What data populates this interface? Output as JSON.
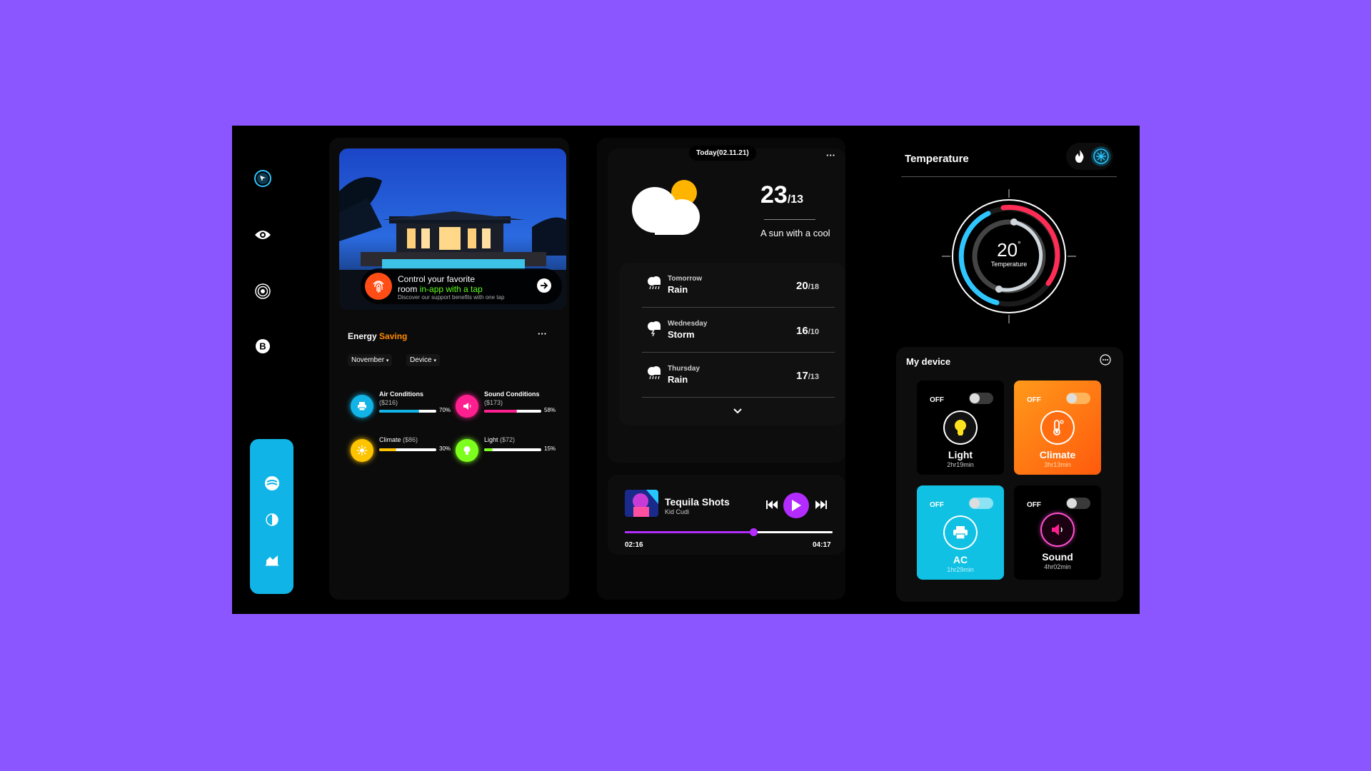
{
  "sidebar": {
    "icons": [
      "compass-icon",
      "eye-icon",
      "target-icon",
      "bitcoin-icon"
    ],
    "pill_icons": [
      "wind-icon",
      "contrast-icon",
      "chart-area-icon"
    ]
  },
  "hero": {
    "line1": "Control your favorite",
    "line2_pre": "room ",
    "line2_accent": "in-app with a tap",
    "sub": "Discover our support benefits with one tap"
  },
  "energy": {
    "title": "Energy",
    "title_accent": "Saving",
    "menu": "···",
    "filters": [
      "November",
      "Device"
    ],
    "items": [
      {
        "name": "Air Conditions",
        "cost": "($216)",
        "percent_label": "70%",
        "percent": 70,
        "color": "#12b3e6",
        "icon": "printer-icon"
      },
      {
        "name": "Sound Conditions",
        "cost": "($173)",
        "percent_label": "58%",
        "percent": 58,
        "color": "#ff1f8e",
        "icon": "speaker-icon"
      },
      {
        "name": "Climate",
        "cost": "($86)",
        "percent_label": "30%",
        "percent": 30,
        "color": "#ffc400",
        "icon": "sun-icon"
      },
      {
        "name": "Light",
        "cost": "($72)",
        "percent_label": "15%",
        "percent": 15,
        "color": "#7dff1e",
        "icon": "bulb-icon"
      }
    ]
  },
  "weather": {
    "date": "Today(02.11.21)",
    "menu": "···",
    "temp": "23",
    "temp_low": "/13",
    "desc": "A sun with a cool",
    "forecast": [
      {
        "day": "Tomorrow",
        "cond": "Rain",
        "hi": "20",
        "lo": "/18"
      },
      {
        "day": "Wednesday",
        "cond": "Storm",
        "hi": "16",
        "lo": "/10"
      },
      {
        "day": "Thursday",
        "cond": "Rain",
        "hi": "17",
        "lo": "/13"
      }
    ]
  },
  "music": {
    "title": "Tequila Shots",
    "artist": "Kid Cudi",
    "elapsed": "02:16",
    "total": "04:17",
    "progress": 0.62
  },
  "temperature": {
    "title": "Temperature",
    "value": "20",
    "unit": "°",
    "label": "Temperature"
  },
  "devices": {
    "title": "My device",
    "items": [
      {
        "state": "OFF",
        "name": "Light",
        "time": "2hr19min",
        "icon": "bulb-icon"
      },
      {
        "state": "OFF",
        "name": "Climate",
        "time": "3hr13min",
        "icon": "thermometer-icon"
      },
      {
        "state": "OFF",
        "name": "AC",
        "time": "1hr29min",
        "icon": "printer-icon"
      },
      {
        "state": "OFF",
        "name": "Sound",
        "time": "4hr02min",
        "icon": "speaker-icon"
      }
    ]
  },
  "colors": {
    "background": "#8b55ff",
    "accent_blue": "#11b4e6",
    "accent_orange": "#ff6d10",
    "accent_purple": "#b22cff",
    "accent_green": "#7dff1e"
  }
}
